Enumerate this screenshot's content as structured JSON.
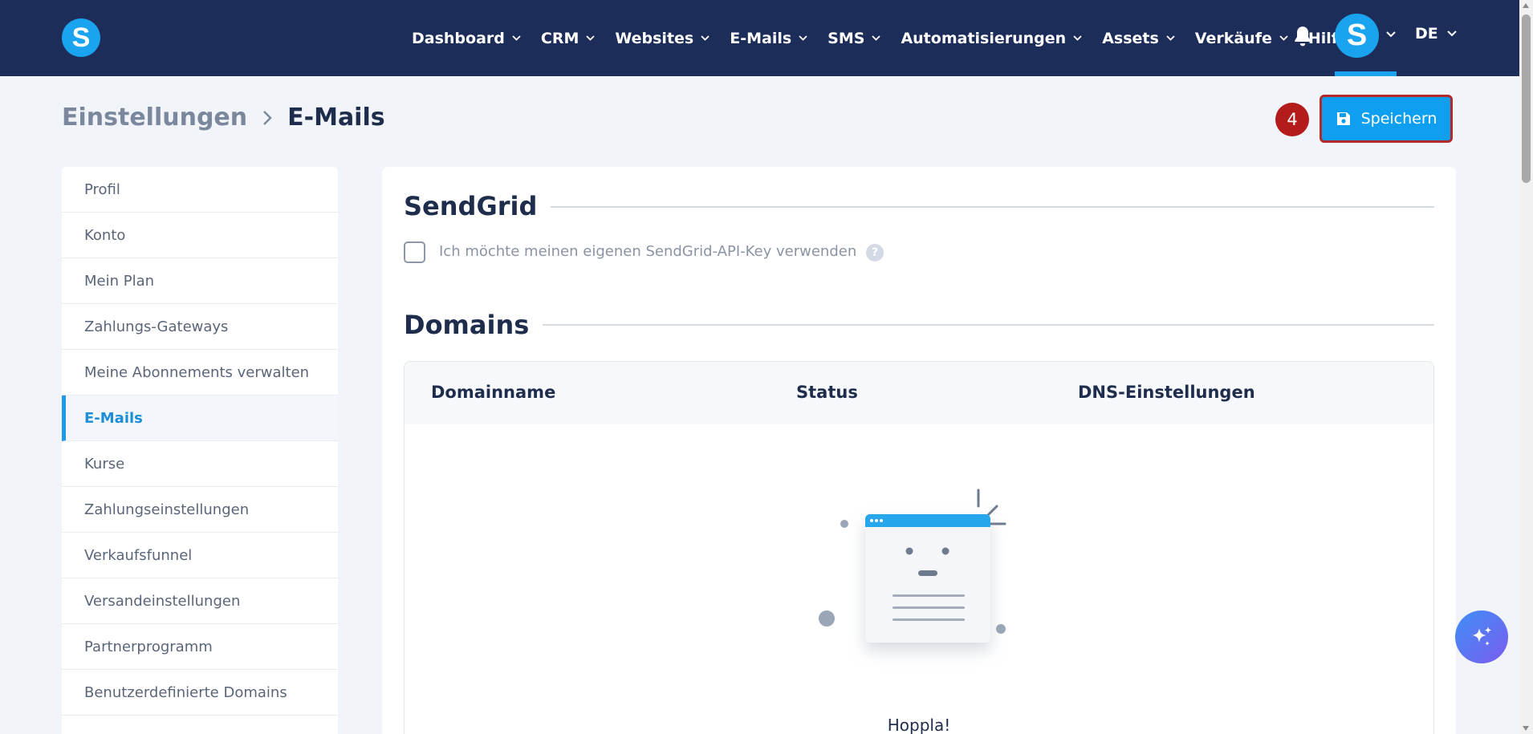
{
  "app": {
    "logo_letter": "S"
  },
  "nav": {
    "items": [
      {
        "label": "Dashboard",
        "has_dropdown": true
      },
      {
        "label": "CRM",
        "has_dropdown": true
      },
      {
        "label": "Websites",
        "has_dropdown": true
      },
      {
        "label": "E-Mails",
        "has_dropdown": true
      },
      {
        "label": "SMS",
        "has_dropdown": true
      },
      {
        "label": "Automatisierungen",
        "has_dropdown": true
      },
      {
        "label": "Assets",
        "has_dropdown": true
      },
      {
        "label": "Verkäufe",
        "has_dropdown": true
      },
      {
        "label": "Hilfe",
        "has_dropdown": false
      }
    ],
    "bell_icon": "bell-icon",
    "avatar_letter": "S",
    "language": "DE"
  },
  "breadcrumb": {
    "parent": "Einstellungen",
    "current": "E-Mails"
  },
  "toolbar": {
    "step_badge": "4",
    "save_label": "Speichern",
    "save_icon": "floppy-disk-icon"
  },
  "sidebar": {
    "items": [
      {
        "label": "Profil",
        "active": false
      },
      {
        "label": "Konto",
        "active": false
      },
      {
        "label": "Mein Plan",
        "active": false
      },
      {
        "label": "Zahlungs-Gateways",
        "active": false
      },
      {
        "label": "Meine Abonnements verwalten",
        "active": false
      },
      {
        "label": "E-Mails",
        "active": true
      },
      {
        "label": "Kurse",
        "active": false
      },
      {
        "label": "Zahlungseinstellungen",
        "active": false
      },
      {
        "label": "Verkaufsfunnel",
        "active": false
      },
      {
        "label": "Versandeinstellungen",
        "active": false
      },
      {
        "label": "Partnerprogramm",
        "active": false
      },
      {
        "label": "Benutzerdefinierte Domains",
        "active": false
      }
    ]
  },
  "sendgrid": {
    "title": "SendGrid",
    "checkbox_label": "Ich möchte meinen eigenen SendGrid-API-Key verwenden",
    "checked": false,
    "help_icon": "question-mark-icon",
    "help_glyph": "?"
  },
  "domains": {
    "title": "Domains",
    "columns": [
      "Domainname",
      "Status",
      "DNS-Einstellungen"
    ],
    "rows": [],
    "empty_text": "Hoppla!"
  },
  "colors": {
    "topbar": "#1d2d5a",
    "accent": "#1aa3ee",
    "save_border": "#b22a2a",
    "badge": "#b41c1c"
  }
}
